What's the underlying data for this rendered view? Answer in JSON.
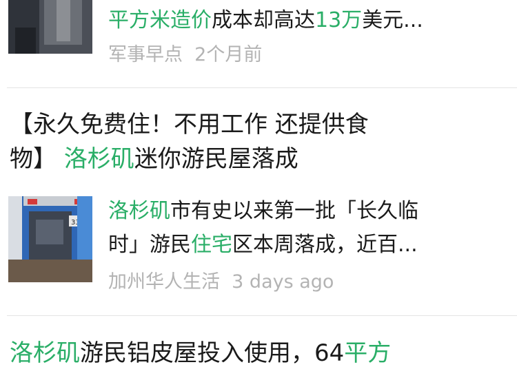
{
  "results": [
    {
      "snippet_parts": [
        {
          "text": "平方米造价",
          "highlight": true
        },
        {
          "text": "成本却高达",
          "highlight": false
        },
        {
          "text": "13万",
          "highlight": true
        },
        {
          "text": "美元...",
          "highlight": false
        }
      ],
      "source": "军事早点",
      "time": "2个月前"
    },
    {
      "title_line1": [
        {
          "text": "【永久免费住！不用工作 还提供食",
          "highlight": false
        }
      ],
      "title_line2": [
        {
          "text": "物】 ",
          "highlight": false
        },
        {
          "text": "洛杉矶",
          "highlight": true
        },
        {
          "text": "迷你游民屋落成",
          "highlight": false
        }
      ],
      "snippet_line1": [
        {
          "text": "洛杉矶",
          "highlight": true
        },
        {
          "text": "市有史以来第一批「长久临",
          "highlight": false
        }
      ],
      "snippet_line2": [
        {
          "text": "时」游民",
          "highlight": false
        },
        {
          "text": "住宅",
          "highlight": true
        },
        {
          "text": "区本周落成，近百...",
          "highlight": false
        }
      ],
      "source": "加州华人生活",
      "time": "3 days ago",
      "thumb_label": "33"
    },
    {
      "title_line1": [
        {
          "text": "洛杉矶",
          "highlight": true
        },
        {
          "text": "游民铝皮屋投入使用，64",
          "highlight": false
        },
        {
          "text": "平方",
          "highlight": true
        }
      ]
    }
  ],
  "colors": {
    "highlight": "#2aae67",
    "source_text": "#b3b3b3",
    "divider": "#e4e4e4"
  }
}
